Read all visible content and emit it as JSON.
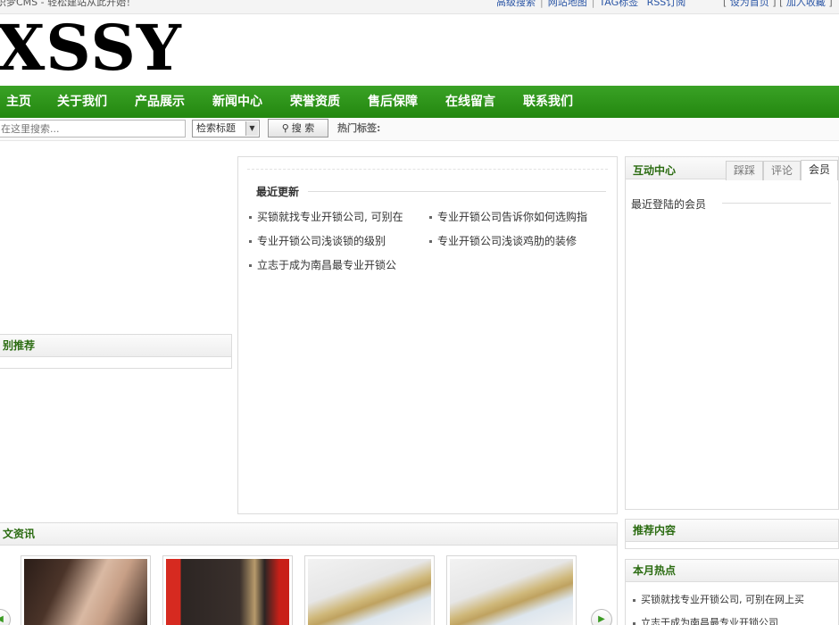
{
  "topbar": {
    "slogan": "织梦CMS - 轻松建站从此开始！",
    "links": [
      "高级搜索",
      "网站地图",
      "TAG标签",
      "RSS订阅"
    ],
    "set_home": "设为首页",
    "add_favorite": "加入收藏",
    "bracket_open": "[",
    "bracket_close": "]"
  },
  "logo": {
    "text": "XSSY"
  },
  "nav": {
    "items": [
      "主页",
      "关于我们",
      "产品展示",
      "新闻中心",
      "荣誉资质",
      "售后保障",
      "在线留言",
      "联系我们"
    ]
  },
  "search": {
    "placeholder": "在这里搜索...",
    "select_value": "检索标题",
    "button_label": "搜 索",
    "hot_tags_label": "热门标签:"
  },
  "left": {
    "recommend_title": "别推荐"
  },
  "center": {
    "section_title": "最近更新",
    "news": [
      "买锁就找专业开锁公司, 可别在",
      "专业开锁公司告诉你如何选购指",
      "专业开锁公司浅谈锁的级别",
      "专业开锁公司浅谈鸡肋的装修",
      "立志于成为南昌最专业开锁公"
    ]
  },
  "interact": {
    "title": "互动中心",
    "tabs": [
      "踩踩",
      "评论",
      "会员"
    ],
    "active_tab": "会员",
    "body_label": "最近登陆的会员"
  },
  "recommend": {
    "title": "推荐内容"
  },
  "hot_month": {
    "title": "本月热点",
    "items": [
      "买锁就找专业开锁公司, 可别在网上买",
      "立志于成为南昌最专业开锁公司"
    ]
  },
  "bottom": {
    "title": "文资讯",
    "thumbs": [
      "lock-photo-1",
      "lock-photo-2",
      "lock-photo-3",
      "lock-photo-4"
    ],
    "prev_icon": "chevron-left-icon",
    "next_icon": "chevron-right-icon"
  },
  "colors": {
    "nav_green": "#2b8f17",
    "link_blue": "#2a55a5",
    "title_green": "#2a6b10"
  }
}
